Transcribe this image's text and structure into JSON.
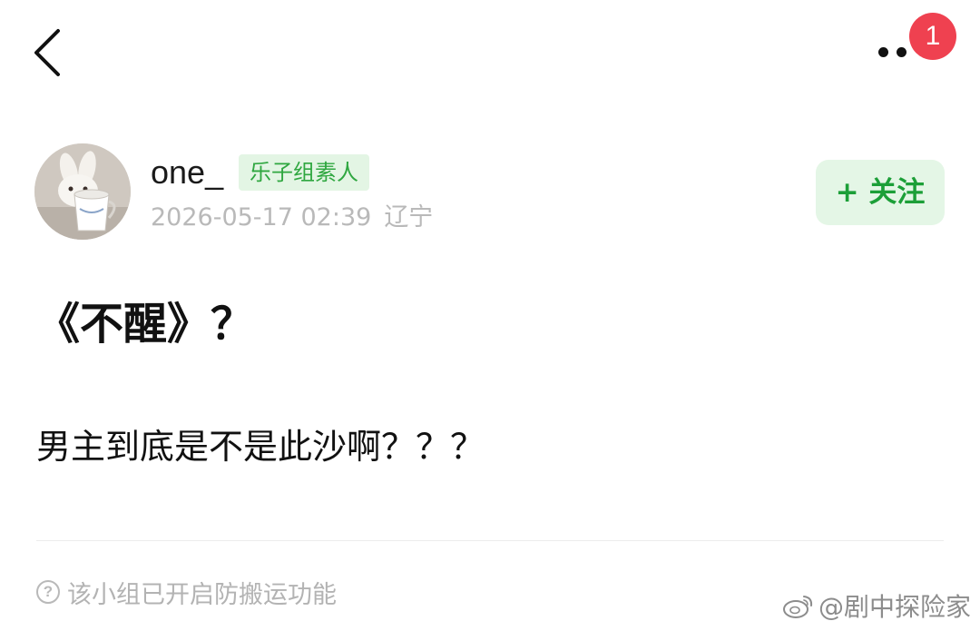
{
  "header": {
    "back_icon": "chevron-left-icon",
    "more_icon": "more-dots-icon",
    "badge_count": "1",
    "badge_color": "#ef4150"
  },
  "author": {
    "username": "one_",
    "group_tag": "乐子组素人",
    "datetime": "2026-05-17 02:39",
    "location": "辽宁",
    "avatar": "rabbit-in-cup-avatar"
  },
  "follow_button": {
    "label": "+ 关注",
    "color": "#1c9f38"
  },
  "post": {
    "title": "《不醒》？",
    "body": "男主到底是不是此沙啊？？？"
  },
  "footer": {
    "notice": "该小组已开启防搬运功能",
    "notice_icon": "question-circle-icon"
  },
  "watermark": {
    "text": "@剧中探险家",
    "icon": "weibo-icon"
  }
}
